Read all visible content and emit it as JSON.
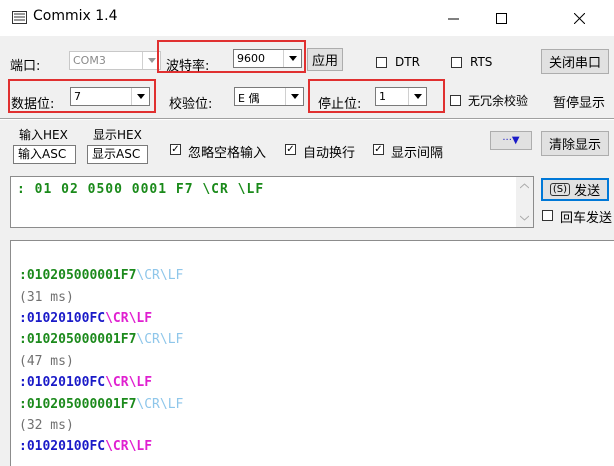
{
  "window": {
    "title": "Commix 1.4"
  },
  "port": {
    "label": "端口:",
    "value": "COM3"
  },
  "baud": {
    "label": "波特率:",
    "value": "9600",
    "apply_label": "应用"
  },
  "dtr": {
    "label": "DTR",
    "checked": false
  },
  "rts": {
    "label": "RTS",
    "checked": false
  },
  "close_port_label": "关闭串口",
  "databits": {
    "label": "数据位:",
    "value": "7"
  },
  "parity": {
    "label": "校验位:",
    "value": "E 偶"
  },
  "stopbits": {
    "label": "停止位:",
    "value": "1"
  },
  "no_redundant": {
    "label": "无冗余校验",
    "checked": false
  },
  "pause_label": "暂停显示",
  "input_mode": {
    "hex": "输入HEX",
    "asc": "输入ASC"
  },
  "display_mode": {
    "hex": "显示HEX",
    "asc": "显示ASC"
  },
  "ignore_space": {
    "label": "忽略空格输入",
    "checked": true
  },
  "auto_wrap": {
    "label": "自动换行",
    "checked": true
  },
  "show_interval": {
    "label": "显示间隔",
    "checked": true
  },
  "more_label": "···▼",
  "clear_label": "清除显示",
  "send": {
    "text": ": 01 02 0500 0001 F7 \\CR \\LF",
    "button_label": "发送",
    "hotkey": "(S)",
    "enter_send_label": "回车发送",
    "enter_send_checked": false
  },
  "receive": [
    {
      "hex": ":010205000001F7",
      "tail": "\\CR\\LF",
      "kind": "tx"
    },
    {
      "interval": "(31 ms)"
    },
    {
      "hex": ":01020100FC",
      "tail": "\\CR\\LF",
      "kind": "rx"
    },
    {
      "hex": ":010205000001F7",
      "tail": "\\CR\\LF",
      "kind": "tx"
    },
    {
      "interval": "(47 ms)"
    },
    {
      "hex": ":01020100FC",
      "tail": "\\CR\\LF",
      "kind": "rx"
    },
    {
      "hex": ":010205000001F7",
      "tail": "\\CR\\LF",
      "kind": "tx"
    },
    {
      "interval": "(32 ms)"
    },
    {
      "hex": ":01020100FC",
      "tail": "\\CR\\LF",
      "kind": "rx"
    }
  ],
  "colors": {
    "tx": "#1c8a1c",
    "rx": "#1a1ac8",
    "rx_tail": "#e020d0",
    "tx_tail": "#8ec6ea",
    "highlight": "#e03030"
  }
}
